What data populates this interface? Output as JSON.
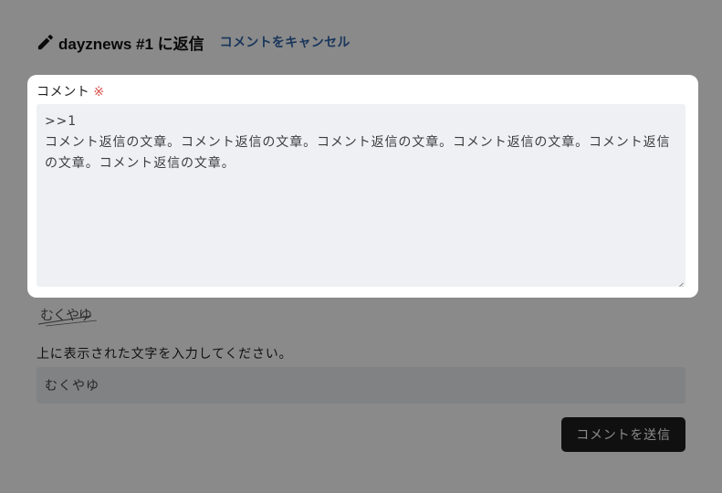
{
  "reply_form": {
    "title": "dayznews #1 に返信",
    "cancel_label": "コメントをキャンセル"
  },
  "comment": {
    "label": "コメント",
    "required_mark": "※",
    "value_line1": ">>1",
    "value_line2": "コメント返信の文章。コメント返信の文章。コメント返信の文章。コメント返信の文章。コメント返信の文章。コメント返信の文章。"
  },
  "captcha": {
    "image_text": "むくやゆ",
    "instruction": "上に表示された文字を入力してください。",
    "input_value": "むくやゆ"
  },
  "submit": {
    "label": "コメントを送信"
  },
  "colors": {
    "accent_link": "#2f64a8",
    "required": "#d9534f",
    "button_bg": "#1f1f1f",
    "field_bg": "#eef0f4"
  },
  "icons": {
    "title_icon": "pencil-icon"
  }
}
